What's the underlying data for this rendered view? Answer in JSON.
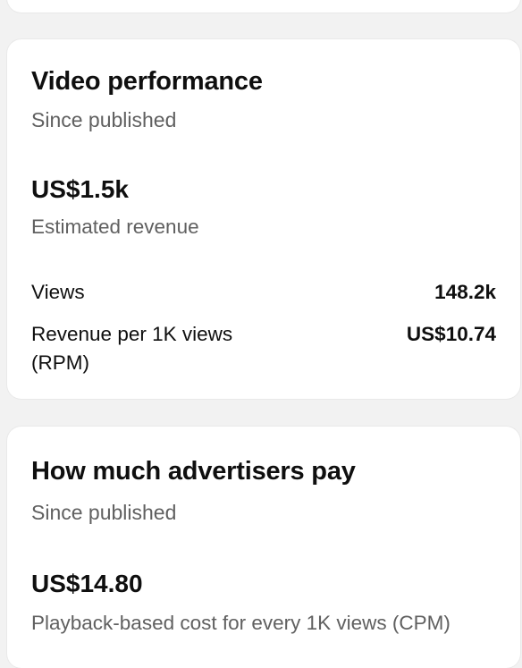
{
  "video_performance": {
    "title": "Video performance",
    "subtitle": "Since published",
    "revenue_value": "US$1.5k",
    "revenue_label": "Estimated revenue",
    "rows": [
      {
        "label": "Views",
        "value": "148.2k"
      },
      {
        "label": "Revenue per 1K views (RPM)",
        "value": "US$10.74"
      }
    ]
  },
  "advertisers": {
    "title": "How much advertisers pay",
    "subtitle": "Since published",
    "cpm_value": "US$14.80",
    "cpm_label": "Playback-based cost for every 1K views (CPM)"
  }
}
